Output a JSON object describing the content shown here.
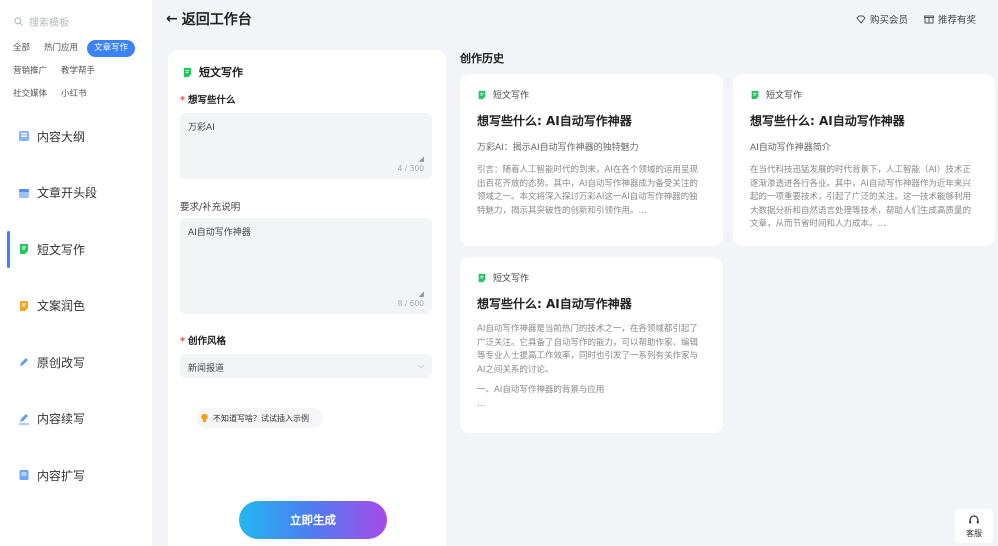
{
  "sidebar": {
    "search_placeholder": "搜索模板",
    "tags": [
      {
        "label": "全部",
        "active": false
      },
      {
        "label": "热门应用",
        "active": false
      },
      {
        "label": "文章写作",
        "active": true
      },
      {
        "label": "营销推广",
        "active": false
      },
      {
        "label": "教学帮手",
        "active": false
      },
      {
        "label": "社交媒体",
        "active": false
      },
      {
        "label": "小红书",
        "active": false
      }
    ],
    "items": [
      {
        "label": "内容大纲",
        "icon": "outline-icon",
        "active": false
      },
      {
        "label": "文章开头段",
        "icon": "calendar-icon",
        "active": false
      },
      {
        "label": "短文写作",
        "icon": "note-icon",
        "active": true
      },
      {
        "label": "文案润色",
        "icon": "doc-icon",
        "active": false
      },
      {
        "label": "原创改写",
        "icon": "pen-icon",
        "active": false
      },
      {
        "label": "内容续写",
        "icon": "edit-icon",
        "active": false
      },
      {
        "label": "内容扩写",
        "icon": "expand-icon",
        "active": false
      }
    ]
  },
  "header": {
    "back_label": "返回工作台",
    "buy_vip": "购买会员",
    "reward": "推荐有奖"
  },
  "form": {
    "title": "短文写作",
    "topic_label": "想写些什么",
    "topic_value": "万彩AI",
    "topic_counter": "4 / 300",
    "extra_label": "要求/补充说明",
    "extra_value": "AI自动写作神器",
    "extra_counter": "8 / 600",
    "style_label": "创作风格",
    "style_value": "新闻报道",
    "hint": "不知道写啥？试试插入示例",
    "generate_label": "立即生成"
  },
  "history": {
    "title": "创作历史",
    "cards": [
      {
        "tag": "短文写作",
        "title": "想写些什么: AI自动写作神器",
        "subtitle": "万彩AI：揭示AI自动写作神器的独特魅力",
        "body": "引言：随着人工智能时代的到来，AI在各个领域的运用呈现出百花齐放的态势。其中，AI自动写作神器成为备受关注的领域之一。本文将深入探讨万彩AI这一AI自动写作神器的独特魅力，揭示其突破性的创新和引领作用。…",
        "body2": ""
      },
      {
        "tag": "短文写作",
        "title": "想写些什么: AI自动写作神器",
        "subtitle": "AI自动写作神器简介",
        "body": "在当代科技迅猛发展的时代背景下，人工智能（AI）技术正逐渐渗透进各行各业。其中，AI自动写作神器作为近年来兴起的一项重要技术，引起了广泛的关注。这一技术能够利用大数据分析和自然语言处理等技术，帮助人们生成高质量的文章，从而节省时间和人力成本。…",
        "body2": ""
      },
      {
        "tag": "短文写作",
        "title": "想写些什么: AI自动写作神器",
        "subtitle": "",
        "body": "AI自动写作神器是当前热门的技术之一，在各领域都引起了广泛关注。它具备了自动写作的能力，可以帮助作家、编辑等专业人士提高工作效率，同时也引发了一系列有关作家与AI之间关系的讨论。",
        "body2": "一、AI自动写作神器的背景与应用\n…"
      }
    ]
  },
  "service_label": "客服",
  "colors": {
    "accent": "#3b82f6",
    "tag_icon": "#22c55e",
    "required": "#e5484d"
  }
}
